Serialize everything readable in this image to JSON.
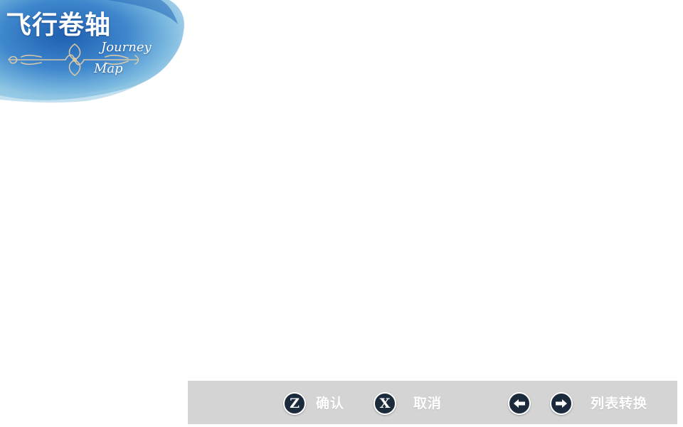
{
  "logo": {
    "title": "飞行卷轴",
    "subtitle_line1": "Journey",
    "subtitle_line2": "Map",
    "wash_colors": [
      "#1f5fb0",
      "#3d86cc",
      "#7ab8df",
      "#b9dcef"
    ],
    "ornament_color": "#d9c7a6"
  },
  "hint_bar": {
    "background": "#d4d4d4",
    "items": [
      {
        "key": "Z",
        "icon": "z-key-icon",
        "label": "确认"
      },
      {
        "key": "X",
        "icon": "x-key-icon",
        "label": "取消"
      },
      {
        "key": "",
        "icon": "arrow-left-icon",
        "label": ""
      },
      {
        "key": "",
        "icon": "arrow-right-icon",
        "label": "列表转换"
      }
    ]
  }
}
